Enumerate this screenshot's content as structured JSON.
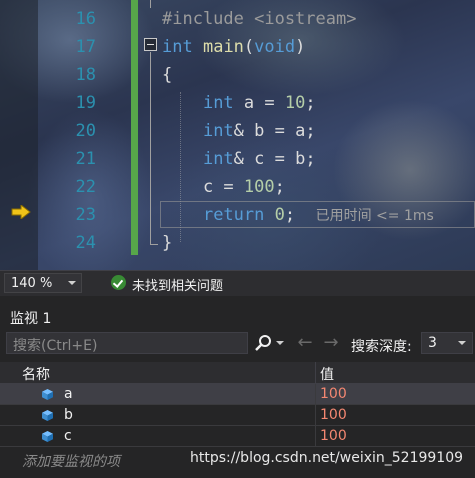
{
  "editor": {
    "line_numbers": [
      "16",
      "17",
      "18",
      "19",
      "20",
      "21",
      "22",
      "23",
      "24"
    ],
    "current_line": "23",
    "lines": [
      {
        "parts": [
          {
            "t": "#include <iostream>",
            "c": "pp"
          }
        ]
      },
      {
        "parts": [
          {
            "t": "int",
            "c": "kw"
          },
          {
            "t": " ",
            "c": "var"
          },
          {
            "t": "main",
            "c": "fn"
          },
          {
            "t": "(",
            "c": "var"
          },
          {
            "t": "void",
            "c": "kw"
          },
          {
            "t": ")",
            "c": "var"
          }
        ]
      },
      {
        "parts": [
          {
            "t": "{",
            "c": "var"
          }
        ]
      },
      {
        "parts": [
          {
            "t": "    ",
            "c": "var"
          },
          {
            "t": "int",
            "c": "kw"
          },
          {
            "t": " a = ",
            "c": "var"
          },
          {
            "t": "10",
            "c": "num"
          },
          {
            "t": ";",
            "c": "var"
          }
        ]
      },
      {
        "parts": [
          {
            "t": "    ",
            "c": "var"
          },
          {
            "t": "int",
            "c": "kw"
          },
          {
            "t": "& b = a;",
            "c": "var"
          }
        ]
      },
      {
        "parts": [
          {
            "t": "    ",
            "c": "var"
          },
          {
            "t": "int",
            "c": "kw"
          },
          {
            "t": "& c = b;",
            "c": "var"
          }
        ]
      },
      {
        "parts": [
          {
            "t": "    c = ",
            "c": "var"
          },
          {
            "t": "100",
            "c": "num"
          },
          {
            "t": ";",
            "c": "var"
          }
        ]
      },
      {
        "parts": [
          {
            "t": "    ",
            "c": "var"
          },
          {
            "t": "return",
            "c": "kw"
          },
          {
            "t": " ",
            "c": "var"
          },
          {
            "t": "0",
            "c": "num"
          },
          {
            "t": ";  ",
            "c": "var"
          },
          {
            "t": "已用时间 <= 1ms",
            "c": "hint"
          }
        ]
      },
      {
        "parts": [
          {
            "t": "}",
            "c": "var"
          }
        ]
      }
    ],
    "icons": {
      "exec_pointer": "execution-arrow-icon",
      "collapse": "collapse-minus-icon"
    }
  },
  "statusbar": {
    "zoom": "140 %",
    "issues_text": "未找到相关问题",
    "issues_icon": "check-circle-icon"
  },
  "watch": {
    "title": "监视 1",
    "search_placeholder": "搜索(Ctrl+E)",
    "search_icon": "search-icon",
    "nav_back": "←",
    "nav_forward": "→",
    "depth_label": "搜索深度:",
    "depth_value": "3",
    "columns": {
      "name": "名称",
      "value": "值"
    },
    "rows": [
      {
        "name": "a",
        "value": "100",
        "icon": "variable-cube-icon"
      },
      {
        "name": "b",
        "value": "100",
        "icon": "variable-cube-icon"
      },
      {
        "name": "c",
        "value": "100",
        "icon": "variable-cube-icon"
      }
    ],
    "add_watch": "添加要监视的项",
    "watermark": "https://blog.csdn.net/weixin_52199109"
  },
  "colors": {
    "keyword": "#569cd6",
    "function": "#dcdcaa",
    "number": "#b5cea8",
    "line_number": "#2b91af",
    "change_bar": "#57a64a",
    "value_changed": "#f48771",
    "accent_exec": "#f0c419"
  }
}
